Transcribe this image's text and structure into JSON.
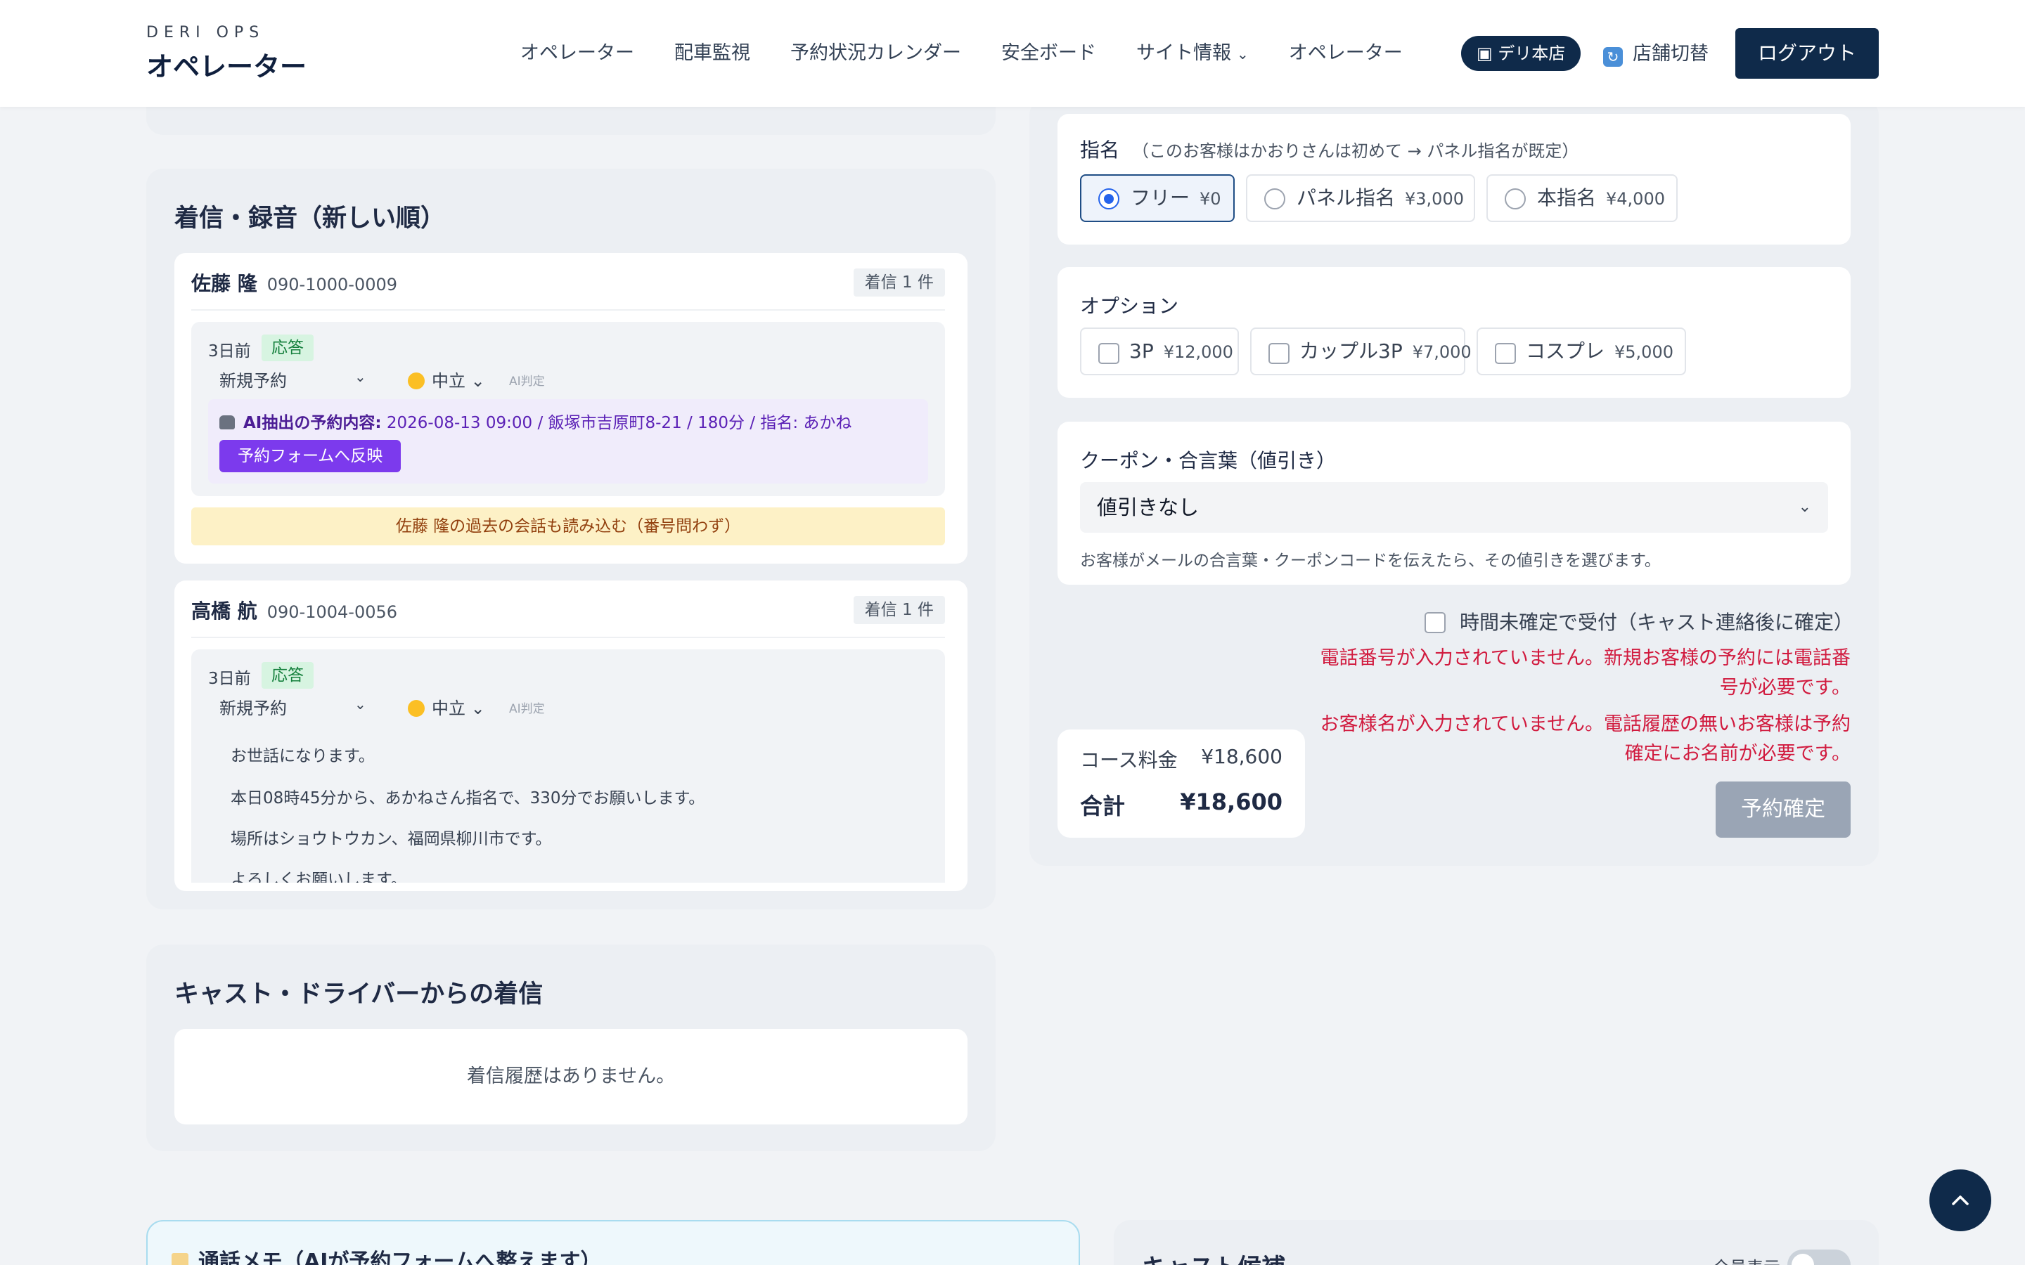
{
  "header": {
    "brand_sub": "DERI OPS",
    "brand_title": "オペレーター",
    "nav": [
      "オペレーター",
      "配車監視",
      "予約状況カレンダー",
      "安全ボード",
      "サイト情報",
      "オペレーター"
    ],
    "shop_badge": "デリ本店",
    "switch_label": "店舗切替",
    "logout_label": "ログアウト"
  },
  "calls": {
    "title": "着信・録音（新しい順）",
    "groups": [
      {
        "name": "佐藤 隆",
        "phone": "090-1000-0009",
        "count": "着信 1 件",
        "item": {
          "ago": "3日前",
          "status": "応答",
          "type": "新規予約",
          "mood": "中立",
          "ai_judge": "AI判定",
          "ai_label": "AI抽出の予約内容:",
          "ai_text": "2026-08-13 09:00 / 飯塚市吉原町8-21 / 180分 / 指名: あかね",
          "apply_label": "予約フォームへ反映"
        },
        "load_past": "佐藤 隆の過去の会話も読み込む（番号問わず）"
      },
      {
        "name": "高橋 航",
        "phone": "090-1004-0056",
        "count": "着信 1 件",
        "item": {
          "ago": "3日前",
          "status": "応答",
          "type": "新規予約",
          "mood": "中立",
          "ai_judge": "AI判定",
          "lines": [
            "お世話になります。",
            "本日08時45分から、あかねさん指名で、330分でお願いします。",
            "場所はショウトウカン、福岡県柳川市です。",
            "よろしくお願いします。"
          ]
        }
      }
    ]
  },
  "cast_calls": {
    "title": "キャスト・ドライバーからの着信",
    "empty": "着信履歴はありません。"
  },
  "memo": {
    "title": "通話メモ（AIが予約フォームへ整えます）"
  },
  "nomination": {
    "label": "指名",
    "note": "（このお客様はかおりさんは初めて → パネル指名が既定）",
    "options": [
      {
        "label": "フリー",
        "price": "¥0",
        "selected": true
      },
      {
        "label": "パネル指名",
        "price": "¥3,000",
        "selected": false
      },
      {
        "label": "本指名",
        "price": "¥4,000",
        "selected": false
      }
    ]
  },
  "options": {
    "label": "オプション",
    "items": [
      {
        "label": "3P",
        "price": "¥12,000"
      },
      {
        "label": "カップル3P",
        "price": "¥7,000"
      },
      {
        "label": "コスプレ",
        "price": "¥5,000"
      }
    ]
  },
  "coupon": {
    "label": "クーポン・合言葉（値引き）",
    "selected": "値引きなし",
    "help": "お客様がメールの合言葉・クーポンコードを伝えたら、その値引きを選びます。"
  },
  "booking": {
    "undecided_label": "時間未確定で受付（キャスト連絡後に確定）",
    "errors": [
      "電話番号が入力されていません。新規お客様の予約には電話番号が必要です。",
      "お客様名が入力されていません。電話履歴の無いお客様は予約確定にお名前が必要です。"
    ],
    "course_label": "コース料金",
    "course_value": "¥18,600",
    "total_label": "合計",
    "total_value": "¥18,600",
    "confirm_label": "予約確定"
  },
  "cast_candidates": {
    "title": "キャスト候補",
    "show_all": "全員表示"
  },
  "colors": {
    "navy": "#0f2a4a",
    "purple": "#7c3aed",
    "error": "#d11a3e",
    "answered_green": "#15803d"
  }
}
